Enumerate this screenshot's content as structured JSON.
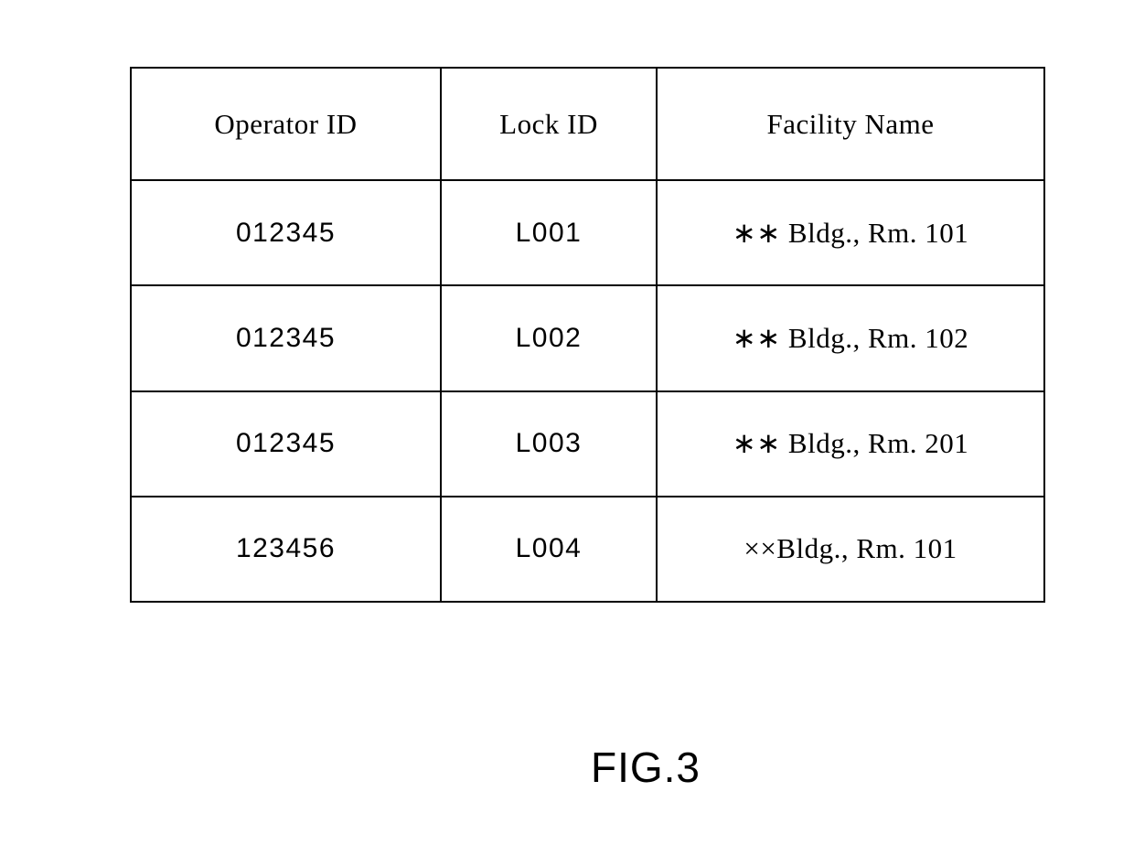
{
  "figure": {
    "caption": "FIG.3",
    "table": {
      "headers": [
        "Operator ID",
        "Lock ID",
        "Facility Name"
      ],
      "rows": [
        {
          "operator_id": "012345",
          "lock_id": "L001",
          "facility_name": "∗∗ Bldg., Rm. 101"
        },
        {
          "operator_id": "012345",
          "lock_id": "L002",
          "facility_name": "∗∗ Bldg., Rm. 102"
        },
        {
          "operator_id": "012345",
          "lock_id": "L003",
          "facility_name": "∗∗ Bldg., Rm. 201"
        },
        {
          "operator_id": "123456",
          "lock_id": "L004",
          "facility_name": "××Bldg., Rm. 101"
        }
      ]
    },
    "colors": {
      "line": "#000000",
      "text": "#000000",
      "background": "#ffffff"
    }
  }
}
